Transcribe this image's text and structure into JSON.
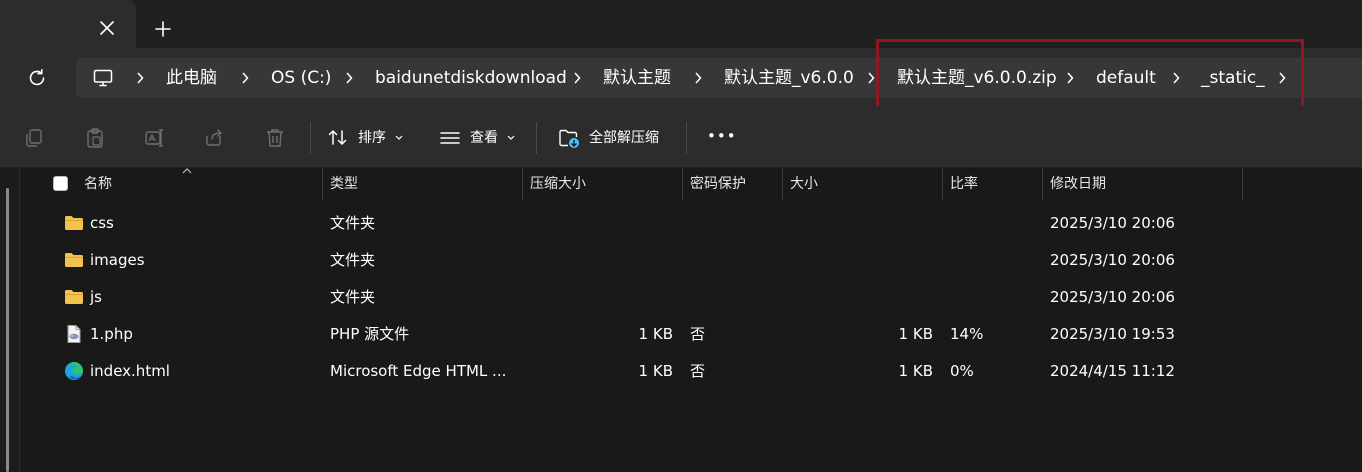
{
  "tabs": {
    "close_icon": "close-icon",
    "add_icon": "plus-icon"
  },
  "navigation": {
    "refresh_icon": "refresh-icon",
    "root_icon": "computer-icon",
    "breadcrumbs": [
      "此电脑",
      "OS (C:)",
      "baidunetdiskdownload",
      "默认主题",
      "默认主题_v6.0.0",
      "默认主题_v6.0.0.zip",
      "default",
      "_static_"
    ]
  },
  "toolbar": {
    "icons": [
      "copy-icon",
      "paste-icon",
      "rename-icon",
      "share-icon",
      "delete-icon"
    ],
    "sort_label": "排序",
    "view_label": "查看",
    "extract_all_label": "全部解压缩",
    "more_label": "•••"
  },
  "columns": {
    "name": "名称",
    "type": "类型",
    "compressed_size": "压缩大小",
    "password": "密码保护",
    "size": "大小",
    "ratio": "比率",
    "modified": "修改日期"
  },
  "files": [
    {
      "name": "css",
      "icon": "folder-icon",
      "type": "文件夹",
      "compressed_size": "",
      "password": "",
      "size": "",
      "ratio": "",
      "modified": "2025/3/10 20:06"
    },
    {
      "name": "images",
      "icon": "folder-icon",
      "type": "文件夹",
      "compressed_size": "",
      "password": "",
      "size": "",
      "ratio": "",
      "modified": "2025/3/10 20:06"
    },
    {
      "name": "js",
      "icon": "folder-icon",
      "type": "文件夹",
      "compressed_size": "",
      "password": "",
      "size": "",
      "ratio": "",
      "modified": "2025/3/10 20:06"
    },
    {
      "name": "1.php",
      "icon": "php-file-icon",
      "type": "PHP 源文件",
      "compressed_size": "1 KB",
      "password": "否",
      "size": "1 KB",
      "ratio": "14%",
      "modified": "2025/3/10 19:53"
    },
    {
      "name": "index.html",
      "icon": "edge-html-icon",
      "type": "Microsoft Edge HTML ...",
      "compressed_size": "1 KB",
      "password": "否",
      "size": "1 KB",
      "ratio": "0%",
      "modified": "2024/4/15 11:12"
    }
  ],
  "colors": {
    "highlight": "#8f1826",
    "folder": "#f2c14e",
    "accent": "#4cc2ff"
  }
}
